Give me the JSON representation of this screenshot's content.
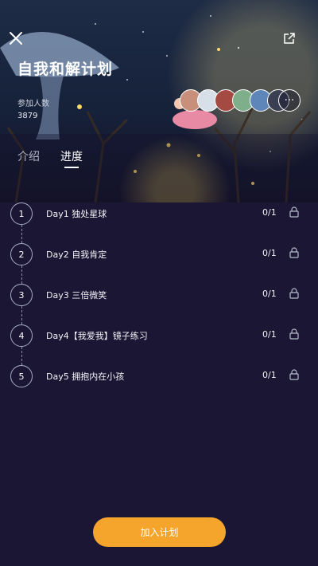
{
  "header": {
    "title": "自我和解计划",
    "members_label": "参加人数",
    "members_count": "3879",
    "more_label": "···"
  },
  "icons": {
    "close": "close-icon",
    "share": "share-icon",
    "lock": "lock-icon"
  },
  "avatars": [
    {
      "name": "avatar-1",
      "color": "#c88f7a"
    },
    {
      "name": "avatar-2",
      "color": "#d7e0e8"
    },
    {
      "name": "avatar-3",
      "color": "#a54a43"
    },
    {
      "name": "avatar-4",
      "color": "#7fae8a"
    },
    {
      "name": "avatar-5",
      "color": "#5f86b8"
    },
    {
      "name": "avatar-6",
      "color": "#3a3f52"
    }
  ],
  "tabs": [
    {
      "label": "介绍",
      "active": false
    },
    {
      "label": "进度",
      "active": true
    }
  ],
  "days": [
    {
      "number": "1",
      "title": "Day1 独处星球",
      "progress": "0/1"
    },
    {
      "number": "2",
      "title": "Day2 自我肯定",
      "progress": "0/1"
    },
    {
      "number": "3",
      "title": "Day3 三倍微笑",
      "progress": "0/1"
    },
    {
      "number": "4",
      "title": "Day4【我爱我】镜子练习",
      "progress": "0/1"
    },
    {
      "number": "5",
      "title": "Day5 拥抱内在小孩",
      "progress": "0/1"
    }
  ],
  "join_button": "加入计划",
  "colors": {
    "background": "#1a1633",
    "accent": "#f5a52c",
    "moon": "#f4d35e"
  }
}
